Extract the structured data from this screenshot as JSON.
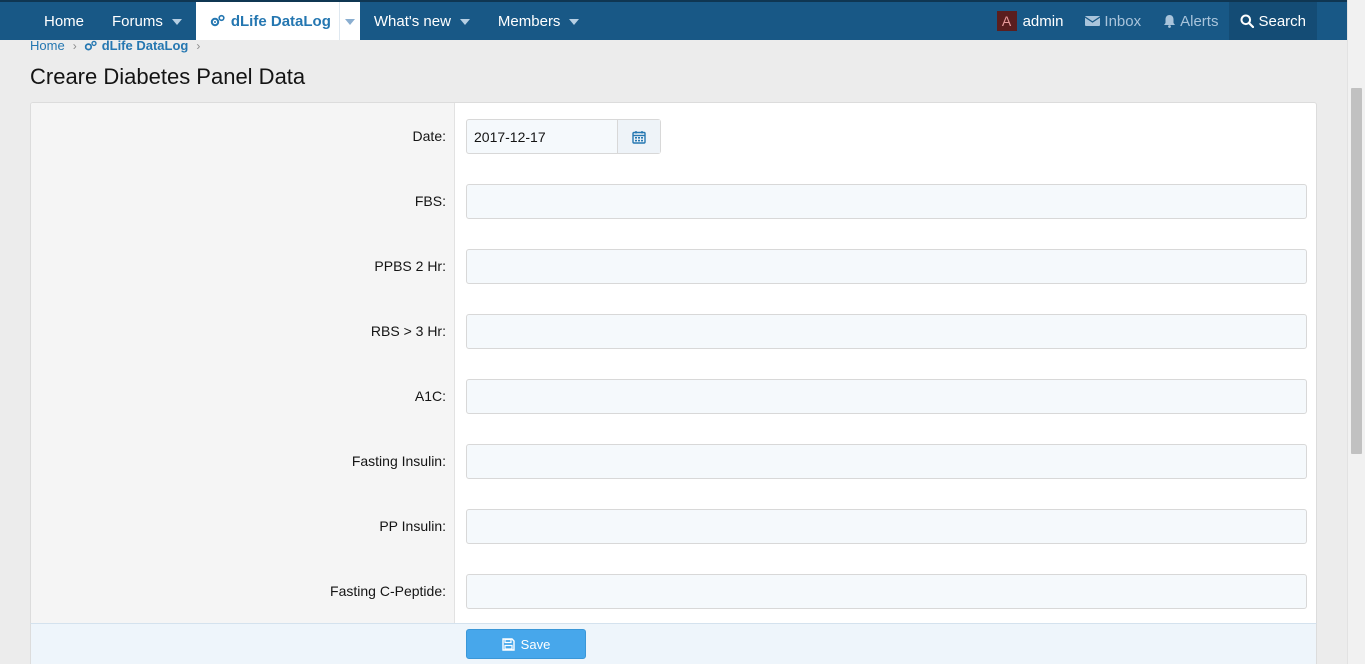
{
  "nav": {
    "home": "Home",
    "forums": "Forums",
    "datalog": "dLife DataLog",
    "whats_new": "What's new",
    "members": "Members",
    "avatar_letter": "A",
    "user": "admin",
    "inbox": "Inbox",
    "alerts": "Alerts",
    "search": "Search"
  },
  "breadcrumb": {
    "home": "Home",
    "datalog": "dLife DataLog"
  },
  "page": {
    "title": "Creare Diabetes Panel Data"
  },
  "form": {
    "date_label": "Date:",
    "date_value": "2017-12-17",
    "fbs_label": "FBS:",
    "ppbs_label": "PPBS 2 Hr:",
    "rbs_label": "RBS > 3 Hr:",
    "a1c_label": "A1C:",
    "fasting_insulin_label": "Fasting Insulin:",
    "pp_insulin_label": "PP Insulin:",
    "fasting_cpeptide_label": "Fasting C-Peptide:",
    "save_label": "Save"
  },
  "colors": {
    "nav_bg": "#185886",
    "accent": "#2577b1",
    "save_button": "#47a7eb"
  }
}
